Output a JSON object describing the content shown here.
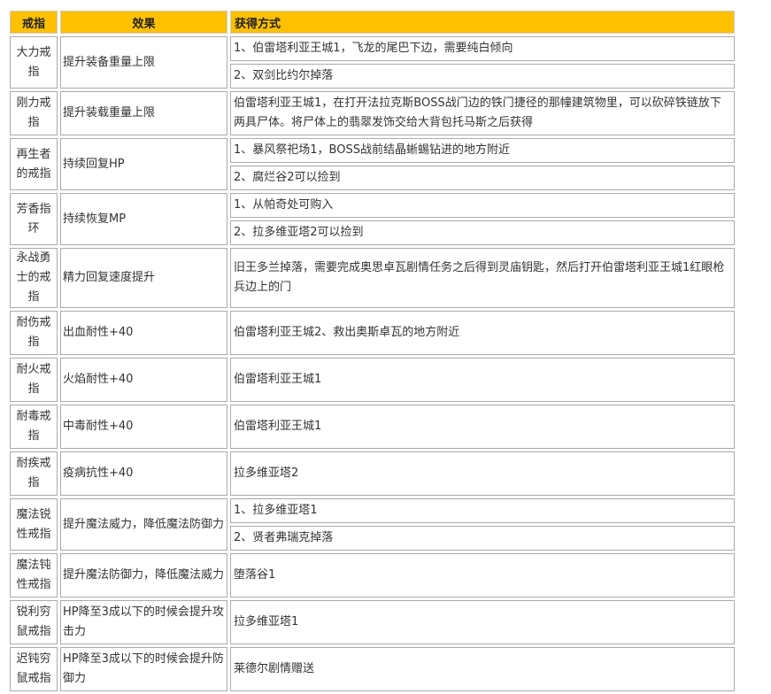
{
  "headers": {
    "name": "戒指",
    "effect": "效果",
    "method": "获得方式"
  },
  "rows": [
    {
      "name": "大力戒指",
      "effect": "提升装备重量上限",
      "methods": [
        "1、伯雷塔利亚王城1，飞龙的尾巴下边，需要纯白倾向",
        "2、双剑比约尔掉落"
      ]
    },
    {
      "name": "刚力戒指",
      "effect": "提升装载重量上限",
      "methods": [
        "伯雷塔利亚王城1，在打开法拉克斯BOSS战门边的铁门捷径的那幢建筑物里，可以砍碎铁链放下两具尸体。将尸体上的翡翠发饰交给大背包托马斯之后获得"
      ]
    },
    {
      "name": "再生者的戒指",
      "effect": "持续回复HP",
      "methods": [
        "1、暴风祭祀场1，BOSS战前结晶蜥蜴钻进的地方附近",
        "2、腐烂谷2可以捡到"
      ]
    },
    {
      "name": "芳香指环",
      "effect": "持续恢复MP",
      "methods": [
        "1、从帕奇处可购入",
        "2、拉多维亚塔2可以捡到"
      ]
    },
    {
      "name": "永战勇士的戒指",
      "effect": "精力回复速度提升",
      "methods": [
        "旧王多兰掉落，需要完成奥思卓瓦剧情任务之后得到灵庙钥匙，然后打开伯雷塔利亚王城1红眼枪兵边上的门"
      ]
    },
    {
      "name": "耐伤戒指",
      "effect": "出血耐性+40",
      "methods": [
        "伯雷塔利亚王城2、救出奥斯卓瓦的地方附近"
      ]
    },
    {
      "name": "耐火戒指",
      "effect": "火焰耐性+40",
      "methods": [
        "伯雷塔利亚王城1"
      ]
    },
    {
      "name": "耐毒戒指",
      "effect": "中毒耐性+40",
      "methods": [
        "伯雷塔利亚王城1"
      ]
    },
    {
      "name": "耐疾戒指",
      "effect": "疫病抗性+40",
      "methods": [
        "拉多维亚塔2"
      ]
    },
    {
      "name": "魔法锐性戒指",
      "effect": "提升魔法威力，降低魔法防御力",
      "methods": [
        "1、拉多维亚塔1",
        "2、贤者弗瑞克掉落"
      ]
    },
    {
      "name": "魔法钝性戒指",
      "effect": "提升魔法防御力，降低魔法威力",
      "methods": [
        "堕落谷1"
      ]
    },
    {
      "name": "锐利穷鼠戒指",
      "effect": "HP降至3成以下的时候会提升攻击力",
      "methods": [
        "拉多维亚塔1"
      ]
    },
    {
      "name": "迟钝穷鼠戒指",
      "effect": "HP降至3成以下的时候会提升防御力",
      "methods": [
        "莱德尔剧情赠送"
      ]
    }
  ]
}
